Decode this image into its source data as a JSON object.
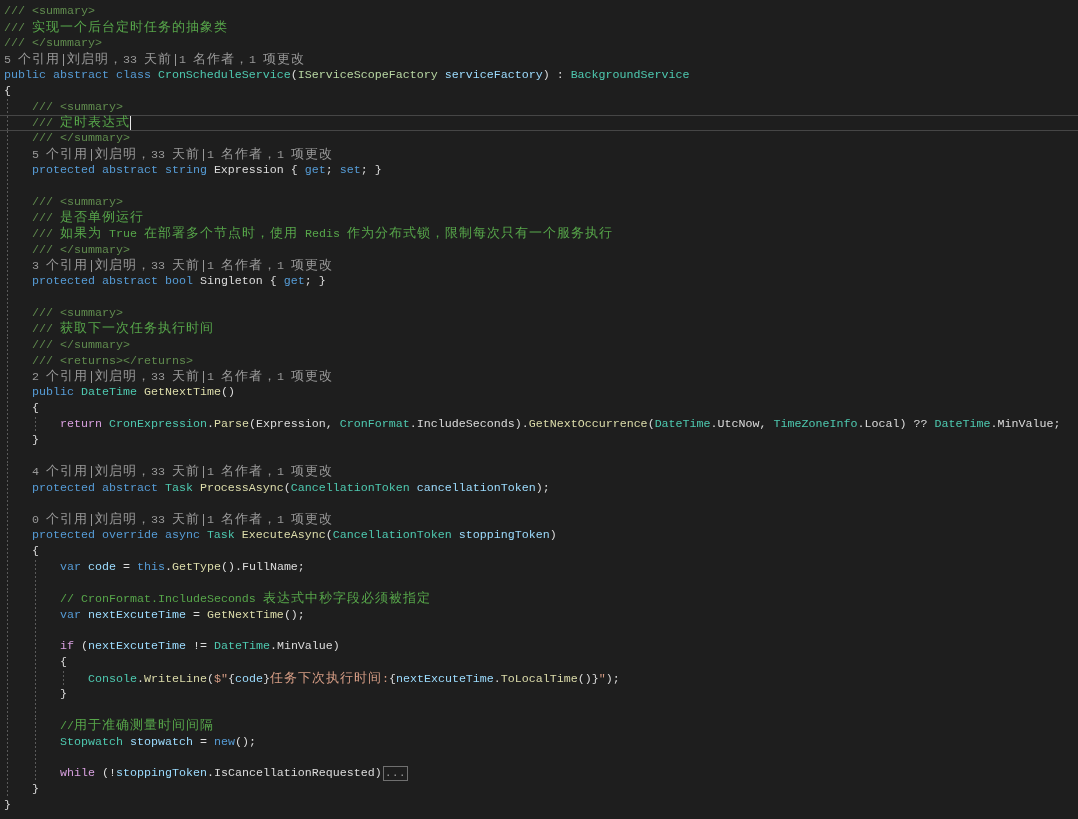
{
  "editor": {
    "lines": [
      {
        "kind": "code",
        "current": false,
        "tokens": [
          {
            "kind": "doc",
            "text": "/// <summary>"
          }
        ]
      },
      {
        "kind": "code",
        "current": false,
        "tokens": [
          {
            "kind": "doc",
            "text": "/// "
          },
          {
            "kind": "doctext",
            "text": "实现一个后台定时任务的抽象类"
          }
        ]
      },
      {
        "kind": "code",
        "current": false,
        "tokens": [
          {
            "kind": "doc",
            "text": "/// </summary>"
          }
        ]
      },
      {
        "kind": "codelens",
        "current": false,
        "links": [
          "5 个引用",
          "刘启明，33 天前",
          "1 名作者，1 项更改"
        ]
      },
      {
        "kind": "code",
        "current": false,
        "tokens": [
          {
            "kind": "keyword",
            "text": "public abstract class "
          },
          {
            "kind": "type",
            "text": "CronScheduleService"
          },
          {
            "kind": "plain",
            "text": "("
          },
          {
            "kind": "interface",
            "text": "IServiceScopeFactory"
          },
          {
            "kind": "variable",
            "text": " serviceFactory"
          },
          {
            "kind": "plain",
            "text": ") : "
          },
          {
            "kind": "type",
            "text": "BackgroundService"
          }
        ]
      },
      {
        "kind": "code",
        "current": false,
        "tokens": [
          {
            "kind": "plain",
            "text": "{"
          }
        ],
        "children": [
          {
            "kind": "code",
            "current": false,
            "tokens": [
              {
                "kind": "doc",
                "text": "/// <summary>"
              }
            ]
          },
          {
            "kind": "code",
            "current": true,
            "tokens": [
              {
                "kind": "doc",
                "text": "/// "
              },
              {
                "kind": "doctext",
                "text": "定时表达式"
              }
            ]
          },
          {
            "kind": "code",
            "current": false,
            "tokens": [
              {
                "kind": "doc",
                "text": "/// </summary>"
              }
            ]
          },
          {
            "kind": "codelens",
            "current": false,
            "links": [
              "5 个引用",
              "刘启明，33 天前",
              "1 名作者，1 项更改"
            ]
          },
          {
            "kind": "code",
            "current": false,
            "tokens": [
              {
                "kind": "keyword",
                "text": "protected abstract string "
              },
              {
                "kind": "plain",
                "text": "Expression { "
              },
              {
                "kind": "keyword",
                "text": "get"
              },
              {
                "kind": "plain",
                "text": "; "
              },
              {
                "kind": "keyword",
                "text": "set"
              },
              {
                "kind": "plain",
                "text": "; }"
              }
            ]
          },
          {
            "kind": "blank",
            "current": false
          },
          {
            "kind": "code",
            "current": false,
            "tokens": [
              {
                "kind": "doc",
                "text": "/// <summary>"
              }
            ]
          },
          {
            "kind": "code",
            "current": false,
            "tokens": [
              {
                "kind": "doc",
                "text": "/// "
              },
              {
                "kind": "doctext",
                "text": "是否单例运行"
              }
            ]
          },
          {
            "kind": "code",
            "current": false,
            "tokens": [
              {
                "kind": "doc",
                "text": "/// "
              },
              {
                "kind": "doctext",
                "text": "如果为 True 在部署多个节点时，使用 Redis 作为分布式锁，限制每次只有一个服务执行"
              }
            ]
          },
          {
            "kind": "code",
            "current": false,
            "tokens": [
              {
                "kind": "doc",
                "text": "/// </summary>"
              }
            ]
          },
          {
            "kind": "codelens",
            "current": false,
            "links": [
              "3 个引用",
              "刘启明，33 天前",
              "1 名作者，1 项更改"
            ]
          },
          {
            "kind": "code",
            "current": false,
            "tokens": [
              {
                "kind": "keyword",
                "text": "protected abstract bool "
              },
              {
                "kind": "plain",
                "text": "Singleton { "
              },
              {
                "kind": "keyword",
                "text": "get"
              },
              {
                "kind": "plain",
                "text": "; }"
              }
            ]
          },
          {
            "kind": "blank",
            "current": false
          },
          {
            "kind": "code",
            "current": false,
            "tokens": [
              {
                "kind": "doc",
                "text": "/// <summary>"
              }
            ]
          },
          {
            "kind": "code",
            "current": false,
            "tokens": [
              {
                "kind": "doc",
                "text": "/// "
              },
              {
                "kind": "doctext",
                "text": "获取下一次任务执行时间"
              }
            ]
          },
          {
            "kind": "code",
            "current": false,
            "tokens": [
              {
                "kind": "doc",
                "text": "/// </summary>"
              }
            ]
          },
          {
            "kind": "code",
            "current": false,
            "tokens": [
              {
                "kind": "doc",
                "text": "/// <returns></returns>"
              }
            ]
          },
          {
            "kind": "codelens",
            "current": false,
            "links": [
              "2 个引用",
              "刘启明，33 天前",
              "1 名作者，1 项更改"
            ]
          },
          {
            "kind": "code",
            "current": false,
            "tokens": [
              {
                "kind": "keyword",
                "text": "public "
              },
              {
                "kind": "type",
                "text": "DateTime"
              },
              {
                "kind": "method",
                "text": " GetNextTime"
              },
              {
                "kind": "plain",
                "text": "()"
              }
            ]
          },
          {
            "kind": "code",
            "current": false,
            "tokens": [
              {
                "kind": "plain",
                "text": "{"
              }
            ],
            "children": [
              {
                "kind": "code",
                "current": false,
                "tokens": [
                  {
                    "kind": "control",
                    "text": "return "
                  },
                  {
                    "kind": "type",
                    "text": "CronExpression"
                  },
                  {
                    "kind": "plain",
                    "text": "."
                  },
                  {
                    "kind": "method",
                    "text": "Parse"
                  },
                  {
                    "kind": "plain",
                    "text": "(Expression, "
                  },
                  {
                    "kind": "type",
                    "text": "CronFormat"
                  },
                  {
                    "kind": "plain",
                    "text": ".IncludeSeconds)."
                  },
                  {
                    "kind": "method",
                    "text": "GetNextOccurrence"
                  },
                  {
                    "kind": "plain",
                    "text": "("
                  },
                  {
                    "kind": "type",
                    "text": "DateTime"
                  },
                  {
                    "kind": "plain",
                    "text": ".UtcNow, "
                  },
                  {
                    "kind": "type",
                    "text": "TimeZoneInfo"
                  },
                  {
                    "kind": "plain",
                    "text": ".Local) ?? "
                  },
                  {
                    "kind": "type",
                    "text": "DateTime"
                  },
                  {
                    "kind": "plain",
                    "text": ".MinValue;"
                  }
                ]
              }
            ]
          },
          {
            "kind": "code",
            "current": false,
            "tokens": [
              {
                "kind": "plain",
                "text": "}"
              }
            ]
          },
          {
            "kind": "blank",
            "current": false
          },
          {
            "kind": "codelens",
            "current": false,
            "links": [
              "4 个引用",
              "刘启明，33 天前",
              "1 名作者，1 项更改"
            ]
          },
          {
            "kind": "code",
            "current": false,
            "tokens": [
              {
                "kind": "keyword",
                "text": "protected abstract "
              },
              {
                "kind": "type",
                "text": "Task"
              },
              {
                "kind": "method",
                "text": " ProcessAsync"
              },
              {
                "kind": "plain",
                "text": "("
              },
              {
                "kind": "type",
                "text": "CancellationToken"
              },
              {
                "kind": "variable",
                "text": " cancellationToken"
              },
              {
                "kind": "plain",
                "text": ");"
              }
            ]
          },
          {
            "kind": "blank",
            "current": false
          },
          {
            "kind": "codelens",
            "current": false,
            "links": [
              "0 个引用",
              "刘启明，33 天前",
              "1 名作者，1 项更改"
            ]
          },
          {
            "kind": "code",
            "current": false,
            "tokens": [
              {
                "kind": "keyword",
                "text": "protected override async "
              },
              {
                "kind": "type",
                "text": "Task"
              },
              {
                "kind": "method",
                "text": " ExecuteAsync"
              },
              {
                "kind": "plain",
                "text": "("
              },
              {
                "kind": "type",
                "text": "CancellationToken"
              },
              {
                "kind": "variable",
                "text": " stoppingToken"
              },
              {
                "kind": "plain",
                "text": ")"
              }
            ]
          },
          {
            "kind": "code",
            "current": false,
            "tokens": [
              {
                "kind": "plain",
                "text": "{"
              }
            ],
            "children": [
              {
                "kind": "code",
                "current": false,
                "tokens": [
                  {
                    "kind": "keyword",
                    "text": "var "
                  },
                  {
                    "kind": "variable",
                    "text": "code"
                  },
                  {
                    "kind": "plain",
                    "text": " = "
                  },
                  {
                    "kind": "keyword",
                    "text": "this"
                  },
                  {
                    "kind": "plain",
                    "text": "."
                  },
                  {
                    "kind": "method",
                    "text": "GetType"
                  },
                  {
                    "kind": "plain",
                    "text": "().FullName;"
                  }
                ]
              },
              {
                "kind": "blank",
                "current": false
              },
              {
                "kind": "code",
                "current": false,
                "tokens": [
                  {
                    "kind": "comment",
                    "text": "// CronFormat.IncludeSeconds 表达式中秒字段必须被指定"
                  }
                ]
              },
              {
                "kind": "code",
                "current": false,
                "tokens": [
                  {
                    "kind": "keyword",
                    "text": "var "
                  },
                  {
                    "kind": "variable",
                    "text": "nextExcuteTime"
                  },
                  {
                    "kind": "plain",
                    "text": " = "
                  },
                  {
                    "kind": "method",
                    "text": "GetNextTime"
                  },
                  {
                    "kind": "plain",
                    "text": "();"
                  }
                ]
              },
              {
                "kind": "blank",
                "current": false
              },
              {
                "kind": "code",
                "current": false,
                "tokens": [
                  {
                    "kind": "control",
                    "text": "if"
                  },
                  {
                    "kind": "plain",
                    "text": " ("
                  },
                  {
                    "kind": "variable",
                    "text": "nextExcuteTime"
                  },
                  {
                    "kind": "plain",
                    "text": " != "
                  },
                  {
                    "kind": "type",
                    "text": "DateTime"
                  },
                  {
                    "kind": "plain",
                    "text": ".MinValue)"
                  }
                ]
              },
              {
                "kind": "code",
                "current": false,
                "tokens": [
                  {
                    "kind": "plain",
                    "text": "{"
                  }
                ],
                "children": [
                  {
                    "kind": "code",
                    "current": false,
                    "tokens": [
                      {
                        "kind": "type",
                        "text": "Console"
                      },
                      {
                        "kind": "plain",
                        "text": "."
                      },
                      {
                        "kind": "method",
                        "text": "WriteLine"
                      },
                      {
                        "kind": "plain",
                        "text": "("
                      },
                      {
                        "kind": "string",
                        "text": "$\""
                      },
                      {
                        "kind": "plain",
                        "text": "{"
                      },
                      {
                        "kind": "variable",
                        "text": "code"
                      },
                      {
                        "kind": "plain",
                        "text": "}"
                      },
                      {
                        "kind": "string",
                        "text": "任务下次执行时间:"
                      },
                      {
                        "kind": "plain",
                        "text": "{"
                      },
                      {
                        "kind": "variable",
                        "text": "nextExcuteTime"
                      },
                      {
                        "kind": "plain",
                        "text": "."
                      },
                      {
                        "kind": "method",
                        "text": "ToLocalTime"
                      },
                      {
                        "kind": "plain",
                        "text": "()}"
                      },
                      {
                        "kind": "string",
                        "text": "\""
                      },
                      {
                        "kind": "plain",
                        "text": ");"
                      }
                    ]
                  }
                ]
              },
              {
                "kind": "code",
                "current": false,
                "tokens": [
                  {
                    "kind": "plain",
                    "text": "}"
                  }
                ]
              },
              {
                "kind": "blank",
                "current": false
              },
              {
                "kind": "code",
                "current": false,
                "tokens": [
                  {
                    "kind": "comment",
                    "text": "//用于准确测量时间间隔"
                  }
                ]
              },
              {
                "kind": "code",
                "current": false,
                "tokens": [
                  {
                    "kind": "type",
                    "text": "Stopwatch"
                  },
                  {
                    "kind": "variable",
                    "text": " stopwatch"
                  },
                  {
                    "kind": "plain",
                    "text": " = "
                  },
                  {
                    "kind": "keyword",
                    "text": "new"
                  },
                  {
                    "kind": "plain",
                    "text": "();"
                  }
                ]
              },
              {
                "kind": "blank",
                "current": false
              },
              {
                "kind": "code",
                "current": false,
                "tokens": [
                  {
                    "kind": "control",
                    "text": "while"
                  },
                  {
                    "kind": "plain",
                    "text": " (!"
                  },
                  {
                    "kind": "variable",
                    "text": "stoppingToken"
                  },
                  {
                    "kind": "plain",
                    "text": ".IsCancellationRequested)"
                  }
                ],
                "fold_marker": "..."
              }
            ]
          },
          {
            "kind": "code",
            "current": false,
            "tokens": [
              {
                "kind": "plain",
                "text": "}"
              }
            ]
          }
        ]
      },
      {
        "kind": "code",
        "current": false,
        "tokens": [
          {
            "kind": "plain",
            "text": "}"
          }
        ]
      }
    ]
  }
}
